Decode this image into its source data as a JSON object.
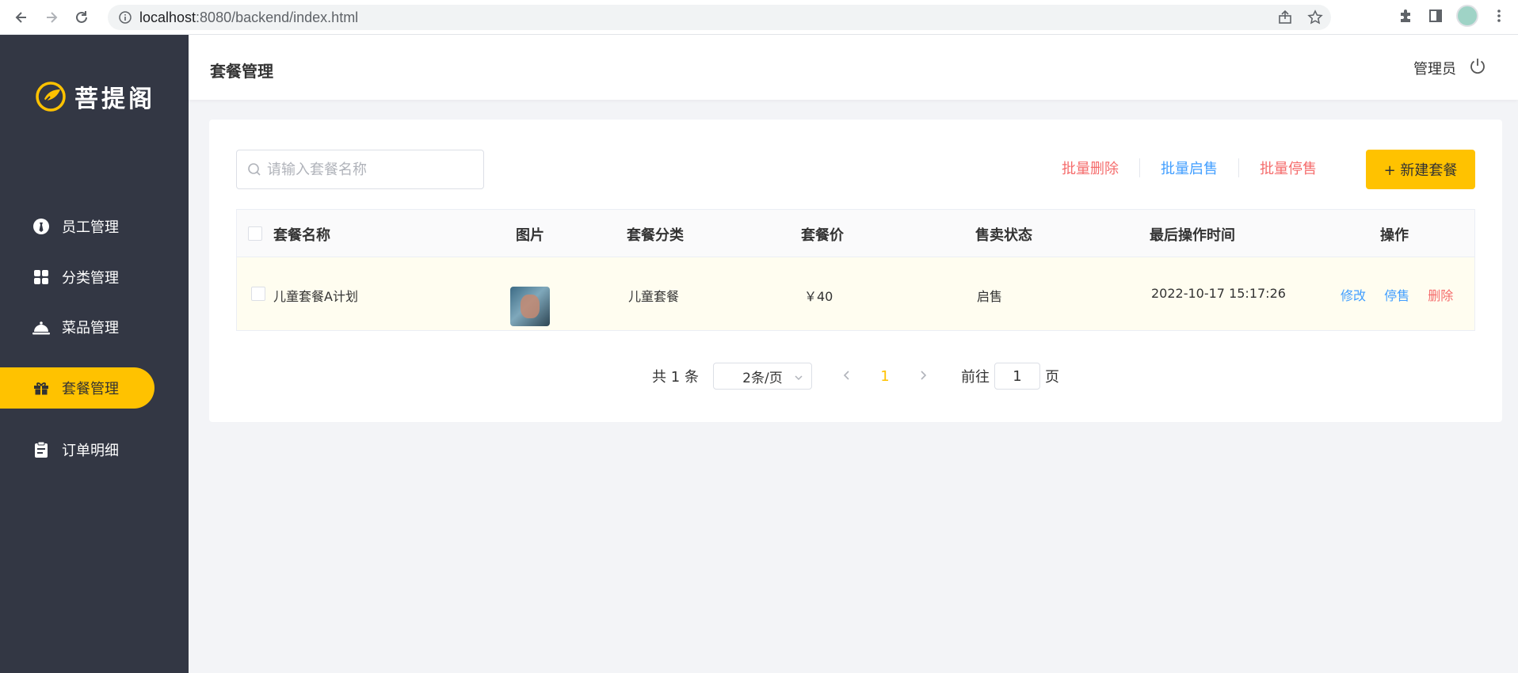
{
  "browser": {
    "url_host": "localhost",
    "url_rest": ":8080/backend/index.html"
  },
  "sidebar": {
    "logo_text": "菩提阁",
    "items": [
      {
        "label": "员工管理",
        "icon": "employee-icon"
      },
      {
        "label": "分类管理",
        "icon": "category-grid-icon"
      },
      {
        "label": "菜品管理",
        "icon": "dish-cloche-icon"
      },
      {
        "label": "套餐管理",
        "icon": "gift-package-icon",
        "active": true
      },
      {
        "label": "订单明细",
        "icon": "clipboard-icon"
      }
    ]
  },
  "header": {
    "title": "套餐管理",
    "user": "管理员"
  },
  "toolbar": {
    "search_placeholder": "请输入套餐名称",
    "batch_delete": "批量删除",
    "batch_enable": "批量启售",
    "batch_disable": "批量停售",
    "new_button": "+ 新建套餐"
  },
  "table": {
    "headers": [
      "套餐名称",
      "图片",
      "套餐分类",
      "套餐价",
      "售卖状态",
      "最后操作时间",
      "操作"
    ],
    "rows": [
      {
        "name": "儿童套餐A计划",
        "category": "儿童套餐",
        "price": "￥40",
        "status": "启售",
        "updated": "2022-10-17 15:17:26",
        "op_edit": "修改",
        "op_toggle": "停售",
        "op_delete": "删除"
      }
    ]
  },
  "pagination": {
    "total": "共 1 条",
    "page_size": "2条/页",
    "current_page": "1",
    "goto_label": "前往",
    "goto_value": "1",
    "page_suffix": "页"
  },
  "colors": {
    "accent": "#ffc200",
    "sidebar_bg": "#333744",
    "link_blue": "#419eff",
    "link_red": "#f56c6c"
  }
}
